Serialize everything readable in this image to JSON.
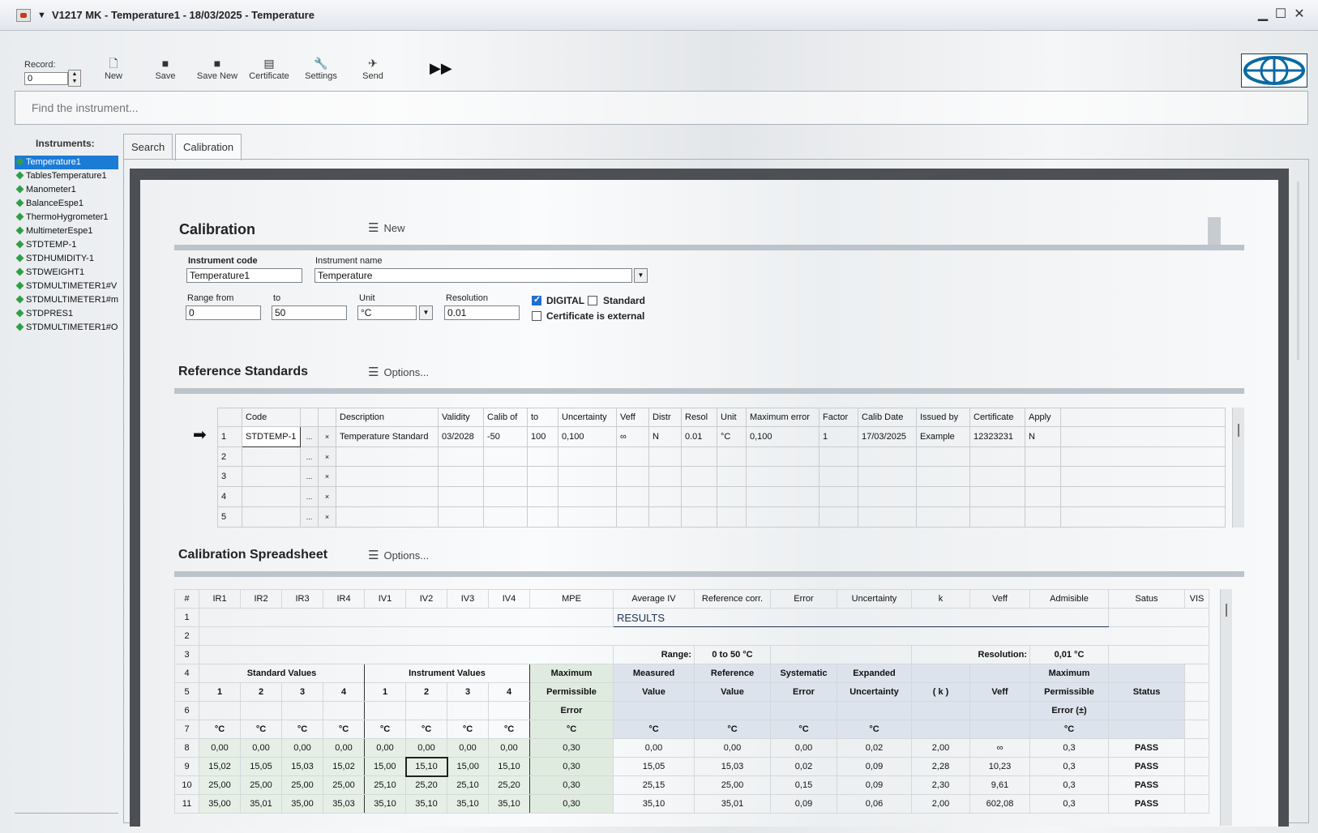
{
  "window": {
    "title": "V1217 MK - Temperature1 - 18/03/2025 - Temperature"
  },
  "toolbar": {
    "record_label": "Record:",
    "record_value": "0",
    "buttons": [
      "New",
      "Save",
      "Save New",
      "Certificate",
      "Settings",
      "Send"
    ]
  },
  "search": {
    "placeholder": "Find the instrument..."
  },
  "sidebar": {
    "title": "Instruments:",
    "items": [
      "Temperature1",
      "TablesTemperature1",
      "Manometer1",
      "BalanceEspe1",
      "ThermoHygrometer1",
      "MultimeterEspe1",
      "STDTEMP-1",
      "STDHUMIDITY-1",
      "STDWEIGHT1",
      "STDMULTIMETER1#V",
      "STDMULTIMETER1#mA",
      "STDPRES1",
      "STDMULTIMETER1#Ohm"
    ]
  },
  "tabs": [
    "Search",
    "Calibration"
  ],
  "calibration": {
    "title": "Calibration",
    "menu": "New",
    "instrument_code_label": "Instrument code",
    "instrument_code": "Temperature1",
    "instrument_name_label": "Instrument name",
    "instrument_name": "Temperature",
    "range_from_label": "Range from",
    "range_from": "0",
    "to_label": "to",
    "to": "50",
    "unit_label": "Unit",
    "unit": "°C",
    "resolution_label": "Resolution",
    "resolution": "0.01",
    "digital_label": "DIGITAL",
    "standard_label": "Standard",
    "external_label": "Certificate is external"
  },
  "reference": {
    "title": "Reference Standards",
    "menu": "Options...",
    "columns": [
      "Code",
      "Description",
      "Validity",
      "Calib of",
      "to",
      "Uncertainty",
      "Veff",
      "Distr",
      "Resol",
      "Unit",
      "Maximum error",
      "Factor",
      "Calib Date",
      "Issued by",
      "Certificate",
      "Apply"
    ],
    "rows": [
      {
        "n": "1",
        "code": "STDTEMP-1",
        "description": "Temperature Standard",
        "validity": "03/2028",
        "calib_of": "-50",
        "to": "100",
        "uncertainty": "0,100",
        "veff": "∞",
        "distr": "N",
        "resol": "0.01",
        "unit": "°C",
        "max_error": "0,100",
        "factor": "1",
        "calib_date": "17/03/2025",
        "issued_by": "Example",
        "certificate": "12323231",
        "apply": "N"
      },
      {
        "n": "2"
      },
      {
        "n": "3"
      },
      {
        "n": "4"
      },
      {
        "n": "5"
      }
    ],
    "btn_dots": "...",
    "btn_x": "×"
  },
  "spreadsheet": {
    "title": "Calibration Spreadsheet",
    "menu": "Options...",
    "columns": [
      "#",
      "IR1",
      "IR2",
      "IR3",
      "IR4",
      "IV1",
      "IV2",
      "IV3",
      "IV4",
      "MPE",
      "Average IV",
      "Reference corr.",
      "Error",
      "Uncertainty",
      "k",
      "Veff",
      "Admisible",
      "Satus",
      "VIS"
    ],
    "results": "RESULTS",
    "range_label": "Range:",
    "range_value": "0 to 50 °C",
    "resolution_label": "Resolution:",
    "resolution_value": "0,01 °C",
    "std_values": "Standard Values",
    "inst_values": "Instrument Values",
    "mpe_header": [
      "Maximum",
      "Permissible",
      "Error"
    ],
    "measured": [
      "Measured",
      "Value"
    ],
    "reference": [
      "Reference",
      "Value"
    ],
    "systematic": [
      "Systematic",
      "Error"
    ],
    "expanded": [
      "Expanded",
      "Uncertainty"
    ],
    "k": "( k )",
    "veff": "Veff",
    "admissible": [
      "Maximum",
      "Permissible",
      "Error (±)"
    ],
    "status": "Status",
    "sub_nums": [
      "1",
      "2",
      "3",
      "4"
    ],
    "unit": "°C",
    "data": [
      {
        "row": "8",
        "ir": [
          "0,00",
          "0,00",
          "0,00",
          "0,00"
        ],
        "iv": [
          "0,00",
          "0,00",
          "0,00",
          "0,00"
        ],
        "mpe": "0,30",
        "avg": "0,00",
        "ref": "0,00",
        "err": "0,00",
        "unc": "0,02",
        "k": "2,00",
        "veff": "∞",
        "adm": "0,3",
        "status": "PASS"
      },
      {
        "row": "9",
        "ir": [
          "15,02",
          "15,05",
          "15,03",
          "15,02"
        ],
        "iv": [
          "15,00",
          "15,10",
          "15,00",
          "15,10"
        ],
        "mpe": "0,30",
        "avg": "15,05",
        "ref": "15,03",
        "err": "0,02",
        "unc": "0,09",
        "k": "2,28",
        "veff": "10,23",
        "adm": "0,3",
        "status": "PASS"
      },
      {
        "row": "10",
        "ir": [
          "25,00",
          "25,00",
          "25,00",
          "25,00"
        ],
        "iv": [
          "25,10",
          "25,20",
          "25,10",
          "25,20"
        ],
        "mpe": "0,30",
        "avg": "25,15",
        "ref": "25,00",
        "err": "0,15",
        "unc": "0,09",
        "k": "2,30",
        "veff": "9,61",
        "adm": "0,3",
        "status": "PASS"
      },
      {
        "row": "11",
        "ir": [
          "35,00",
          "35,01",
          "35,00",
          "35,03"
        ],
        "iv": [
          "35,10",
          "35,10",
          "35,10",
          "35,10"
        ],
        "mpe": "0,30",
        "avg": "35,10",
        "ref": "35,01",
        "err": "0,09",
        "unc": "0,06",
        "k": "2,00",
        "veff": "602,08",
        "adm": "0,3",
        "status": "PASS"
      }
    ]
  }
}
